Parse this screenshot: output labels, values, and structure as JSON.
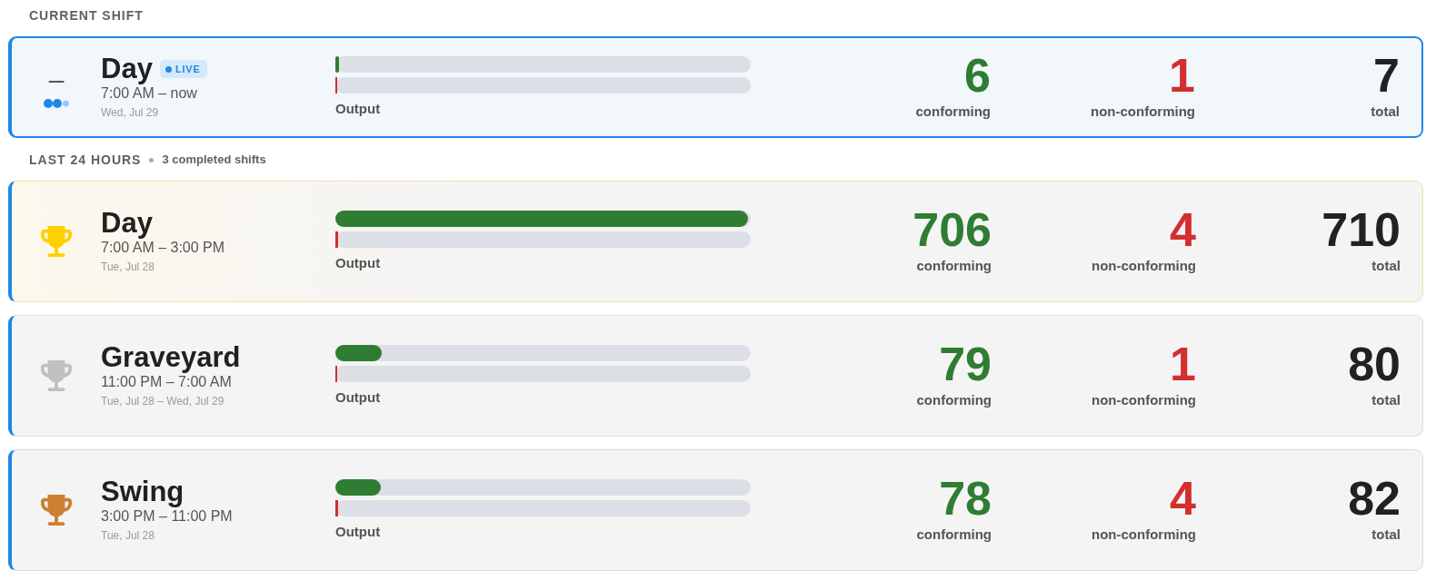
{
  "current_shift": {
    "title": "CURRENT SHIFT",
    "shift": {
      "name": "Day",
      "live": true,
      "highlighted": false,
      "badge": "LIVE",
      "rank": "–",
      "time": "7:00 AM – now",
      "date": "Wed, Jul 29",
      "bars": [
        {
          "kind": "conforming",
          "level": 0.008
        },
        {
          "kind": "non_conforming",
          "level": 0.0014
        }
      ],
      "bars_label": "Output",
      "stats": [
        {
          "kind": "conforming",
          "value": "6",
          "label": "conforming"
        },
        {
          "kind": "non_conforming",
          "value": "1",
          "label": "non-conforming"
        },
        {
          "kind": "total",
          "value": "7",
          "label": "total"
        }
      ]
    }
  },
  "last_24_hours": {
    "title": "LAST 24 HOURS",
    "subtitle": "3 completed shifts",
    "shifts": [
      {
        "name": "Day",
        "live": false,
        "highlighted": true,
        "color": "#ffd000",
        "time": "7:00 AM – 3:00 PM",
        "date": "Tue, Jul 28",
        "bars": [
          {
            "kind": "conforming",
            "level": 0.994
          },
          {
            "kind": "non_conforming",
            "level": 0.006
          }
        ],
        "bars_label": "Output",
        "stats": [
          {
            "kind": "conforming",
            "value": "706",
            "label": "conforming"
          },
          {
            "kind": "non_conforming",
            "value": "4",
            "label": "non-conforming"
          },
          {
            "kind": "total",
            "value": "710",
            "label": "total"
          }
        ]
      },
      {
        "name": "Graveyard",
        "live": false,
        "highlighted": false,
        "color": "#c0c0c0",
        "time": "11:00 PM – 7:00 AM",
        "date": "Tue, Jul 28 – Wed, Jul 29",
        "bars": [
          {
            "kind": "conforming",
            "level": 0.111
          },
          {
            "kind": "non_conforming",
            "level": 0.0014
          }
        ],
        "bars_label": "Output",
        "stats": [
          {
            "kind": "conforming",
            "value": "79",
            "label": "conforming"
          },
          {
            "kind": "non_conforming",
            "value": "1",
            "label": "non-conforming"
          },
          {
            "kind": "total",
            "value": "80",
            "label": "total"
          }
        ]
      },
      {
        "name": "Swing",
        "live": false,
        "highlighted": false,
        "color": "#cd7f32",
        "time": "3:00 PM – 11:00 PM",
        "date": "Tue, Jul 28",
        "bars": [
          {
            "kind": "conforming",
            "level": 0.11
          },
          {
            "kind": "non_conforming",
            "level": 0.006
          }
        ],
        "bars_label": "Output",
        "stats": [
          {
            "kind": "conforming",
            "value": "78",
            "label": "conforming"
          },
          {
            "kind": "non_conforming",
            "value": "4",
            "label": "non-conforming"
          },
          {
            "kind": "total",
            "value": "82",
            "label": "total"
          }
        ]
      }
    ]
  }
}
